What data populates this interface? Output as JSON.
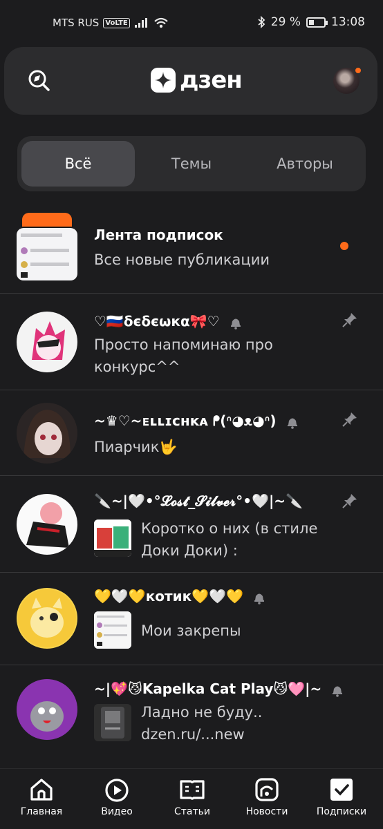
{
  "status": {
    "carrier": "MTS RUS",
    "volte": "VoLTE",
    "battery": "29 %",
    "time": "13:08"
  },
  "header": {
    "logo_text": "дзен"
  },
  "tabs": [
    {
      "label": "Всё",
      "active": true
    },
    {
      "label": "Темы",
      "active": false
    },
    {
      "label": "Авторы",
      "active": false
    }
  ],
  "feed": {
    "title": "Лента подписок",
    "subtitle": "Все новые публикации"
  },
  "items": [
    {
      "name": "♡🇷🇺δєδєωкα🎀♡",
      "line1": "Просто напоминаю про",
      "line2": "конкурс^^"
    },
    {
      "name": "~♛♡~ᴇʟʟɪᴄʜᴋᴀ ⁠ᖰ(ᐢ⁠◕ᴥ◕⁠ᐢ)",
      "line1": "Пиарчик🤟"
    },
    {
      "name": "🔪~|🤍•°𝓛𝓸𝓼𝓽_𝓢𝓲𝓵𝓿𝓮𝓻°•🤍|~🔪",
      "line1": "Коротко о них (в стиле",
      "line2": "Доки Доки) :"
    },
    {
      "name": "💛🤍💛котик💛🤍💛",
      "line1": "Мои закрепы"
    },
    {
      "name": "~|💖😼Kapelka Cat Play😼🩷|~",
      "line1": "Ладно не буду..",
      "line2": "dzen.ru/...new"
    }
  ],
  "nav": [
    {
      "label": "Главная",
      "icon": "home-icon"
    },
    {
      "label": "Видео",
      "icon": "video-icon"
    },
    {
      "label": "Статьи",
      "icon": "articles-icon"
    },
    {
      "label": "Новости",
      "icon": "news-icon"
    },
    {
      "label": "Подписки",
      "icon": "subscriptions-icon"
    }
  ],
  "colors": {
    "accent": "#ff6b1a",
    "bg": "#1c1c1e",
    "card": "#2c2c2e"
  }
}
